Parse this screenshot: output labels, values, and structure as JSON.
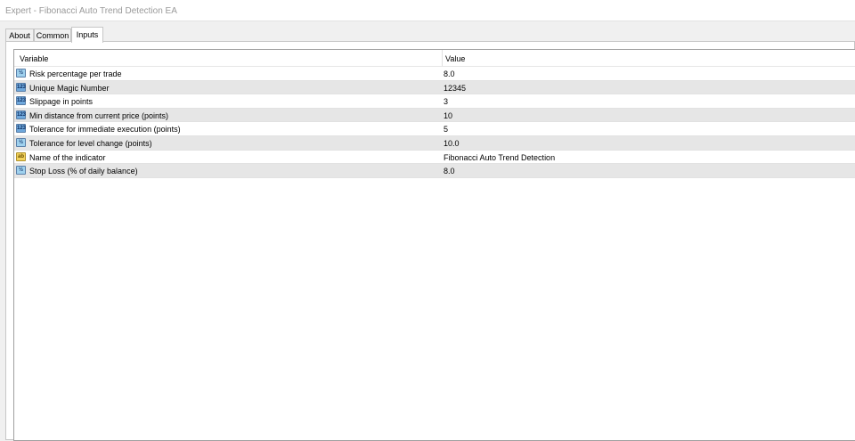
{
  "window": {
    "title": "Expert - Fibonacci Auto Trend Detection EA"
  },
  "tabs": [
    {
      "label": "About",
      "active": false
    },
    {
      "label": "Common",
      "active": false
    },
    {
      "label": "Inputs",
      "active": true
    }
  ],
  "table": {
    "columns": [
      "Variable",
      "Value"
    ],
    "rows": [
      {
        "icon": "double-type-icon",
        "icon_glyph": "½",
        "name": "Risk percentage per trade",
        "value": "8.0"
      },
      {
        "icon": "integer-type-icon",
        "icon_glyph": "123",
        "name": "Unique Magic Number",
        "value": "12345"
      },
      {
        "icon": "integer-type-icon",
        "icon_glyph": "123",
        "name": "Slippage in points",
        "value": "3"
      },
      {
        "icon": "integer-type-icon",
        "icon_glyph": "123",
        "name": "Min distance from current price (points)",
        "value": "10"
      },
      {
        "icon": "integer-type-icon",
        "icon_glyph": "123",
        "name": "Tolerance for immediate execution (points)",
        "value": "5"
      },
      {
        "icon": "double-type-icon",
        "icon_glyph": "½",
        "name": "Tolerance for level change (points)",
        "value": "10.0"
      },
      {
        "icon": "string-type-icon",
        "icon_glyph": "ab",
        "name": "Name of the indicator",
        "value": "Fibonacci Auto Trend Detection"
      },
      {
        "icon": "double-type-icon",
        "icon_glyph": "½",
        "name": "Stop Loss (% of daily balance)",
        "value": "8.0"
      }
    ]
  }
}
